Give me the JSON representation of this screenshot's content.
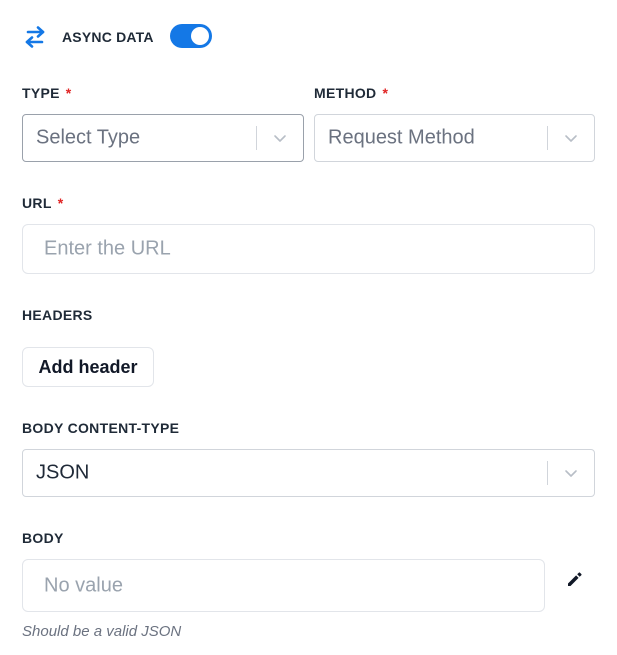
{
  "async": {
    "title": "ASYNC DATA",
    "enabled": true,
    "icon": "arrows-swap-icon",
    "accent": "#1478e6"
  },
  "type": {
    "label": "TYPE",
    "required_mark": "*",
    "placeholder": "Select Type"
  },
  "method": {
    "label": "METHOD",
    "required_mark": "*",
    "placeholder": "Request Method"
  },
  "url": {
    "label": "URL",
    "required_mark": "*",
    "placeholder": "Enter the URL"
  },
  "headers": {
    "label": "HEADERS",
    "add_button": "Add header"
  },
  "body_content_type": {
    "label": "BODY CONTENT-TYPE",
    "value": "JSON"
  },
  "body": {
    "label": "BODY",
    "placeholder": "No value",
    "hint": "Should be a valid JSON",
    "edit_icon": "pencil-icon"
  },
  "colors": {
    "required": "#e02424",
    "toggle_on": "#1478e6"
  }
}
